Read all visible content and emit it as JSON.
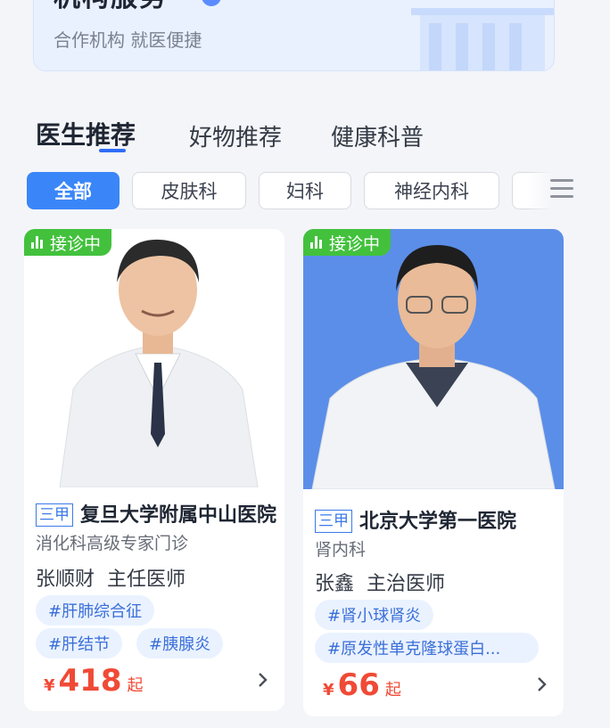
{
  "banner": {
    "title": "机构服务",
    "subtitle": "合作机构 就医便捷"
  },
  "tabs": [
    {
      "label": "医生推荐",
      "active": true
    },
    {
      "label": "好物推荐",
      "active": false
    },
    {
      "label": "健康科普",
      "active": false
    }
  ],
  "filters": [
    {
      "label": "全部",
      "active": true
    },
    {
      "label": "皮肤科",
      "active": false
    },
    {
      "label": "妇科",
      "active": false
    },
    {
      "label": "神经内科",
      "active": false
    }
  ],
  "doctors": [
    {
      "status": "接诊中",
      "level": "三甲",
      "hospital": "复旦大学附属中山医院",
      "department": "消化科高级专家门诊",
      "name": "张顺财",
      "title": "主任医师",
      "tags": [
        "#肝肺综合征",
        "#肝结节",
        "#胰腺炎"
      ],
      "currency": "¥",
      "price": "418",
      "price_unit": "起"
    },
    {
      "status": "接诊中",
      "level": "三甲",
      "hospital": "北京大学第一医院",
      "department": "肾内科",
      "name": "张鑫",
      "title": "主治医师",
      "tags": [
        "#肾小球肾炎",
        "#原发性单克隆球蛋白..."
      ],
      "currency": "¥",
      "price": "66",
      "price_unit": "起"
    }
  ],
  "colors": {
    "accent": "#3a86f8",
    "status_green": "#43c13d",
    "price_red": "#f04a36",
    "tag_bg": "#eaf2ff"
  }
}
